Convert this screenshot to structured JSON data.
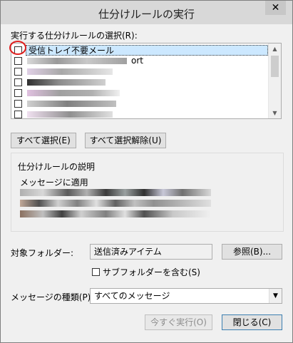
{
  "window": {
    "title": "仕分けルールの実行",
    "close_glyph": "✕"
  },
  "rules_section": {
    "label": "実行する仕分けルールの選択(R):",
    "items": [
      {
        "label": "受信トレイ不要メール",
        "selected": true
      },
      {
        "label": "ort",
        "selected": false
      },
      {
        "label": "",
        "selected": false
      },
      {
        "label": "",
        "selected": false
      },
      {
        "label": "",
        "selected": false
      },
      {
        "label": "",
        "selected": false
      },
      {
        "label": "",
        "selected": false
      }
    ]
  },
  "buttons": {
    "select_all": "すべて選択(E)",
    "deselect_all": "すべて選択解除(U)",
    "browse": "参照(B)...",
    "run_now": "今すぐ実行(O)",
    "close": "閉じる(C)"
  },
  "description": {
    "title": "仕分けルールの説明",
    "applies_to": "メッセージに適用"
  },
  "target_folder": {
    "label": "対象フォルダー:",
    "value": "送信済みアイテム",
    "include_subfolders": "サブフォルダーを含む(S)"
  },
  "message_type": {
    "label": "メッセージの種類(P):",
    "value": "すべてのメッセージ"
  },
  "colors": {
    "accent": "#3c7fb1",
    "selection": "#cce8ff",
    "highlight_circle": "#e02020"
  }
}
